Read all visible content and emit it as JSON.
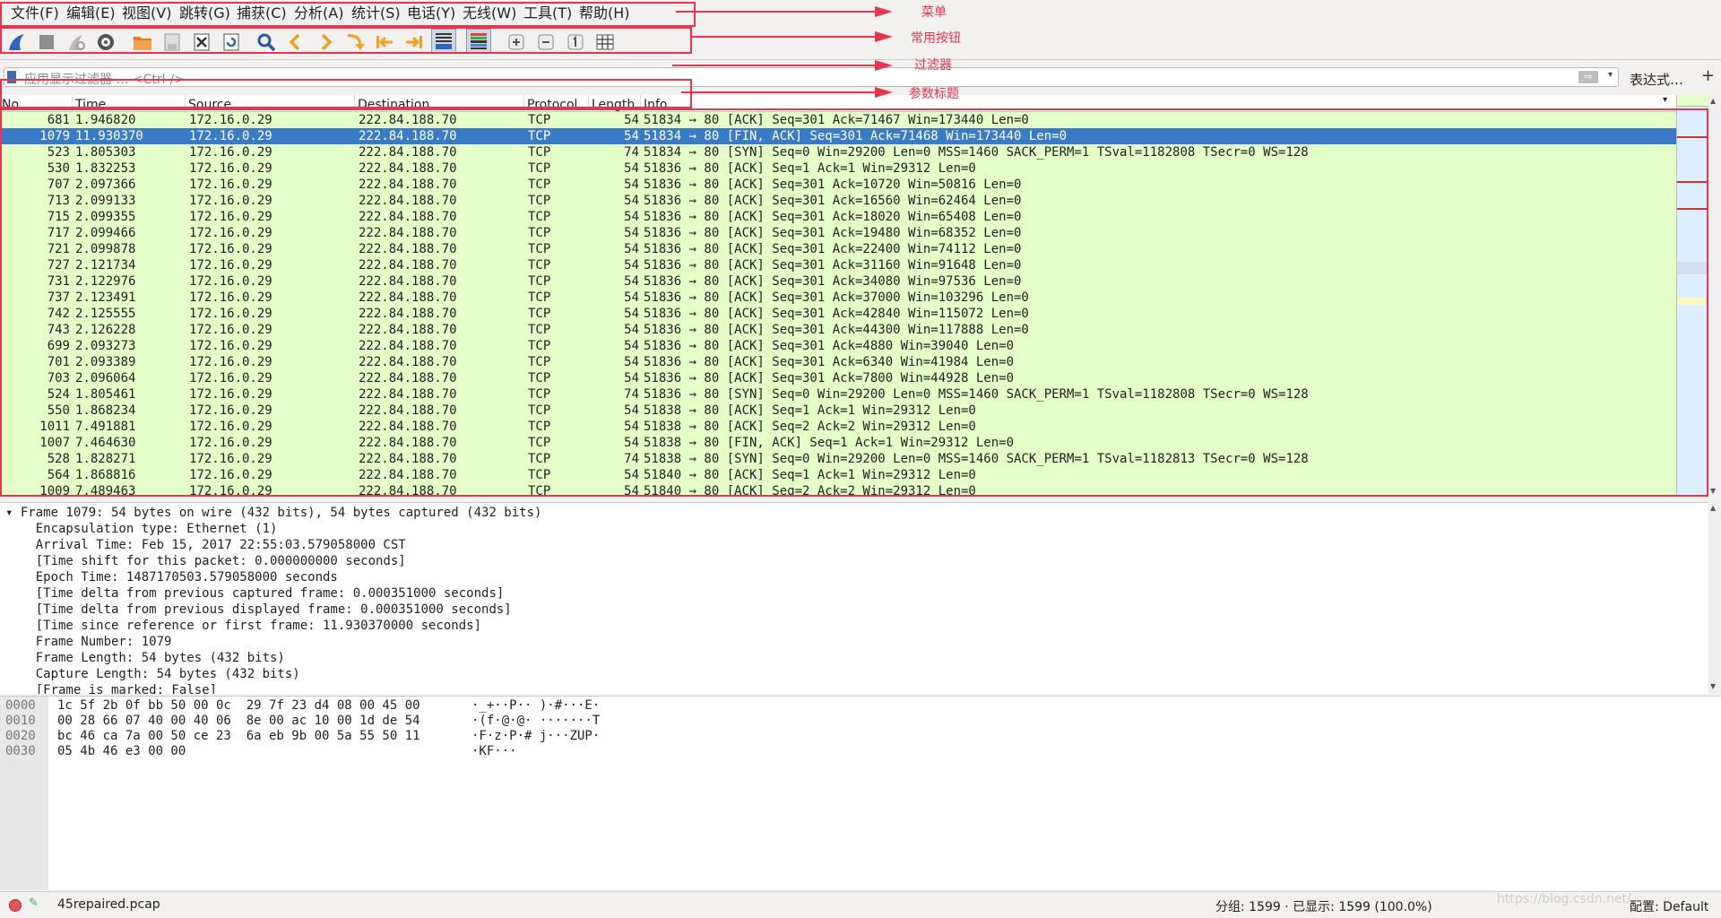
{
  "menu": [
    "文件(F)",
    "编辑(E)",
    "视图(V)",
    "跳转(G)",
    "捕获(C)",
    "分析(A)",
    "统计(S)",
    "电话(Y)",
    "无线(W)",
    "工具(T)",
    "帮助(H)"
  ],
  "toolbar_icons": [
    "shark-fin-start-icon",
    "stop-capture-icon",
    "restart-capture-icon",
    "capture-options-icon",
    "open-file-icon",
    "save-file-icon",
    "close-file-icon",
    "reload-file-icon",
    "find-packet-icon",
    "go-back-icon",
    "go-forward-icon",
    "go-to-packet-icon",
    "first-packet-icon",
    "last-packet-icon",
    "autoscroll-icon",
    "colorize-icon",
    "zoom-in-icon",
    "zoom-out-icon",
    "normal-size-icon",
    "resize-columns-icon"
  ],
  "filter": {
    "placeholder": "应用显示过滤器 … <Ctrl-/>",
    "expression_label": "表达式…",
    "add_label": "+"
  },
  "columns": [
    "No.",
    "Time",
    "Source",
    "Destination",
    "Protocol",
    "Length",
    "Info"
  ],
  "packets": [
    {
      "no": "681",
      "time": "1.946820",
      "src": "172.16.0.29",
      "dst": "222.84.188.70",
      "proto": "TCP",
      "len": "54",
      "info": "51834 → 80 [ACK] Seq=301 Ack=71467 Win=173440 Len=0"
    },
    {
      "no": "1079",
      "time": "11.930370",
      "src": "172.16.0.29",
      "dst": "222.84.188.70",
      "proto": "TCP",
      "len": "54",
      "info": "51834 → 80 [FIN, ACK] Seq=301 Ack=71468 Win=173440 Len=0",
      "selected": true
    },
    {
      "no": "523",
      "time": "1.805303",
      "src": "172.16.0.29",
      "dst": "222.84.188.70",
      "proto": "TCP",
      "len": "74",
      "info": "51834 → 80 [SYN] Seq=0 Win=29200 Len=0 MSS=1460 SACK_PERM=1 TSval=1182808 TSecr=0 WS=128"
    },
    {
      "no": "530",
      "time": "1.832253",
      "src": "172.16.0.29",
      "dst": "222.84.188.70",
      "proto": "TCP",
      "len": "54",
      "info": "51836 → 80 [ACK] Seq=1 Ack=1 Win=29312 Len=0"
    },
    {
      "no": "707",
      "time": "2.097366",
      "src": "172.16.0.29",
      "dst": "222.84.188.70",
      "proto": "TCP",
      "len": "54",
      "info": "51836 → 80 [ACK] Seq=301 Ack=10720 Win=50816 Len=0"
    },
    {
      "no": "713",
      "time": "2.099133",
      "src": "172.16.0.29",
      "dst": "222.84.188.70",
      "proto": "TCP",
      "len": "54",
      "info": "51836 → 80 [ACK] Seq=301 Ack=16560 Win=62464 Len=0"
    },
    {
      "no": "715",
      "time": "2.099355",
      "src": "172.16.0.29",
      "dst": "222.84.188.70",
      "proto": "TCP",
      "len": "54",
      "info": "51836 → 80 [ACK] Seq=301 Ack=18020 Win=65408 Len=0"
    },
    {
      "no": "717",
      "time": "2.099466",
      "src": "172.16.0.29",
      "dst": "222.84.188.70",
      "proto": "TCP",
      "len": "54",
      "info": "51836 → 80 [ACK] Seq=301 Ack=19480 Win=68352 Len=0"
    },
    {
      "no": "721",
      "time": "2.099878",
      "src": "172.16.0.29",
      "dst": "222.84.188.70",
      "proto": "TCP",
      "len": "54",
      "info": "51836 → 80 [ACK] Seq=301 Ack=22400 Win=74112 Len=0"
    },
    {
      "no": "727",
      "time": "2.121734",
      "src": "172.16.0.29",
      "dst": "222.84.188.70",
      "proto": "TCP",
      "len": "54",
      "info": "51836 → 80 [ACK] Seq=301 Ack=31160 Win=91648 Len=0"
    },
    {
      "no": "731",
      "time": "2.122976",
      "src": "172.16.0.29",
      "dst": "222.84.188.70",
      "proto": "TCP",
      "len": "54",
      "info": "51836 → 80 [ACK] Seq=301 Ack=34080 Win=97536 Len=0"
    },
    {
      "no": "737",
      "time": "2.123491",
      "src": "172.16.0.29",
      "dst": "222.84.188.70",
      "proto": "TCP",
      "len": "54",
      "info": "51836 → 80 [ACK] Seq=301 Ack=37000 Win=103296 Len=0"
    },
    {
      "no": "742",
      "time": "2.125555",
      "src": "172.16.0.29",
      "dst": "222.84.188.70",
      "proto": "TCP",
      "len": "54",
      "info": "51836 → 80 [ACK] Seq=301 Ack=42840 Win=115072 Len=0"
    },
    {
      "no": "743",
      "time": "2.126228",
      "src": "172.16.0.29",
      "dst": "222.84.188.70",
      "proto": "TCP",
      "len": "54",
      "info": "51836 → 80 [ACK] Seq=301 Ack=44300 Win=117888 Len=0"
    },
    {
      "no": "699",
      "time": "2.093273",
      "src": "172.16.0.29",
      "dst": "222.84.188.70",
      "proto": "TCP",
      "len": "54",
      "info": "51836 → 80 [ACK] Seq=301 Ack=4880 Win=39040 Len=0"
    },
    {
      "no": "701",
      "time": "2.093389",
      "src": "172.16.0.29",
      "dst": "222.84.188.70",
      "proto": "TCP",
      "len": "54",
      "info": "51836 → 80 [ACK] Seq=301 Ack=6340 Win=41984 Len=0"
    },
    {
      "no": "703",
      "time": "2.096064",
      "src": "172.16.0.29",
      "dst": "222.84.188.70",
      "proto": "TCP",
      "len": "54",
      "info": "51836 → 80 [ACK] Seq=301 Ack=7800 Win=44928 Len=0"
    },
    {
      "no": "524",
      "time": "1.805461",
      "src": "172.16.0.29",
      "dst": "222.84.188.70",
      "proto": "TCP",
      "len": "74",
      "info": "51836 → 80 [SYN] Seq=0 Win=29200 Len=0 MSS=1460 SACK_PERM=1 TSval=1182808 TSecr=0 WS=128"
    },
    {
      "no": "550",
      "time": "1.868234",
      "src": "172.16.0.29",
      "dst": "222.84.188.70",
      "proto": "TCP",
      "len": "54",
      "info": "51838 → 80 [ACK] Seq=1 Ack=1 Win=29312 Len=0"
    },
    {
      "no": "1011",
      "time": "7.491881",
      "src": "172.16.0.29",
      "dst": "222.84.188.70",
      "proto": "TCP",
      "len": "54",
      "info": "51838 → 80 [ACK] Seq=2 Ack=2 Win=29312 Len=0"
    },
    {
      "no": "1007",
      "time": "7.464630",
      "src": "172.16.0.29",
      "dst": "222.84.188.70",
      "proto": "TCP",
      "len": "54",
      "info": "51838 → 80 [FIN, ACK] Seq=1 Ack=1 Win=29312 Len=0"
    },
    {
      "no": "528",
      "time": "1.828271",
      "src": "172.16.0.29",
      "dst": "222.84.188.70",
      "proto": "TCP",
      "len": "74",
      "info": "51838 → 80 [SYN] Seq=0 Win=29200 Len=0 MSS=1460 SACK_PERM=1 TSval=1182813 TSecr=0 WS=128"
    },
    {
      "no": "564",
      "time": "1.868816",
      "src": "172.16.0.29",
      "dst": "222.84.188.70",
      "proto": "TCP",
      "len": "54",
      "info": "51840 → 80 [ACK] Seq=1 Ack=1 Win=29312 Len=0"
    },
    {
      "no": "1009",
      "time": "7.489463",
      "src": "172.16.0.29",
      "dst": "222.84.188.70",
      "proto": "TCP",
      "len": "54",
      "info": "51840 → 80 [ACK] Seq=2 Ack=2 Win=29312 Len=0"
    }
  ],
  "details": [
    "▾ Frame 1079: 54 bytes on wire (432 bits), 54 bytes captured (432 bits)",
    "    Encapsulation type: Ethernet (1)",
    "    Arrival Time: Feb 15, 2017 22:55:03.579058000 CST",
    "    [Time shift for this packet: 0.000000000 seconds]",
    "    Epoch Time: 1487170503.579058000 seconds",
    "    [Time delta from previous captured frame: 0.000351000 seconds]",
    "    [Time delta from previous displayed frame: 0.000351000 seconds]",
    "    [Time since reference or first frame: 11.930370000 seconds]",
    "    Frame Number: 1079",
    "    Frame Length: 54 bytes (432 bits)",
    "    Capture Length: 54 bytes (432 bits)",
    "    [Frame is marked: False]"
  ],
  "bytes": [
    {
      "offset": "0000",
      "hex": "1c 5f 2b 0f bb 50 00 0c  29 7f 23 d4 08 00 45 00",
      "ascii": "·_+··P·· )·#···E·"
    },
    {
      "offset": "0010",
      "hex": "00 28 66 07 40 00 40 06  8e 00 ac 10 00 1d de 54",
      "ascii": "·(f·@·@· ·······T"
    },
    {
      "offset": "0020",
      "hex": "bc 46 ca 7a 00 50 ce 23  6a eb 9b 00 5a 55 50 11",
      "ascii": "·F·z·P·# j···ZUP·"
    },
    {
      "offset": "0030",
      "hex": "05 4b 46 e3 00 00",
      "ascii": "·KF···"
    }
  ],
  "status": {
    "file_name": "45repaired.pcap",
    "packets_summary": "分组: 1599 · 已显示: 1599 (100.0%)",
    "profile": "配置: Default",
    "watermark": "https://blog.csdn.net/..."
  },
  "annotations": [
    "菜单",
    "常用按钮",
    "过滤器",
    "参数标题"
  ],
  "colors": {
    "annotation": "#e8344e",
    "tcp_row": "#e4ffc7",
    "selected_row": "#3a7bc8"
  }
}
